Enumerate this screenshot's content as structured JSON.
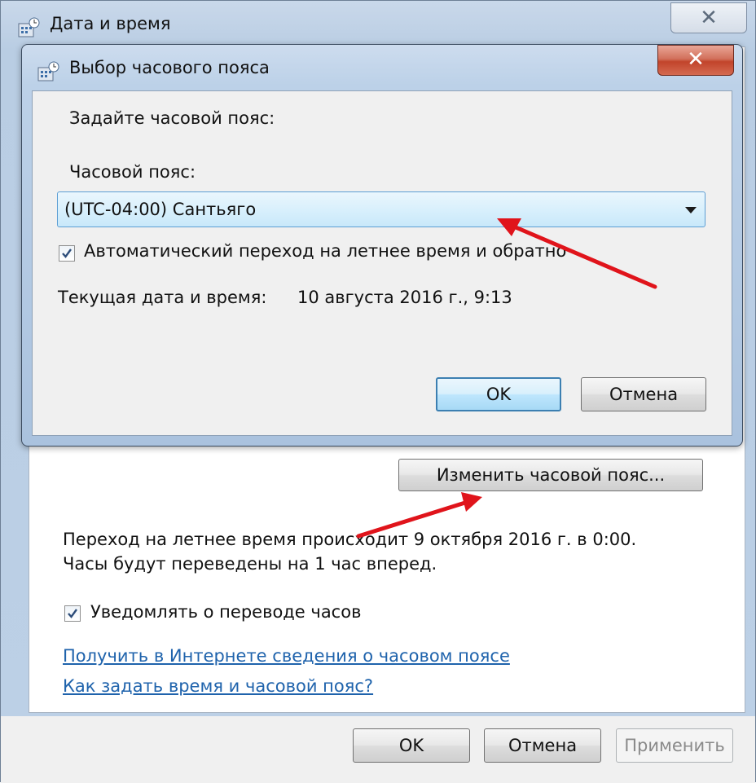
{
  "outer_window": {
    "title": "Дата и время",
    "close_glyph": "✕",
    "change_timezone_button": "Изменить часовой пояс...",
    "dst_info": "Переход на летнее время происходит 9 октября 2016 г. в 0:00. Часы будут переведены на 1 час вперед.",
    "notify_checkbox": {
      "label": "Уведомлять о переводе часов",
      "checked": true
    },
    "links": [
      "Получить в Интернете сведения о часовом поясе",
      "Как задать время и часовой пояс?"
    ],
    "buttons": {
      "ok": "OK",
      "cancel": "Отмена",
      "apply": "Применить"
    },
    "icon": "date-time-icon"
  },
  "timezone_dialog": {
    "title": "Выбор часового пояса",
    "close_glyph": "✕",
    "prompt": "Задайте часовой пояс:",
    "timezone_label": "Часовой пояс:",
    "timezone_value": "(UTC-04:00) Сантьяго",
    "auto_dst_checkbox": {
      "label": "Автоматический переход на летнее время и обратно",
      "checked": true
    },
    "current_datetime_label": "Текущая дата и время:",
    "current_datetime_value": "10 августа 2016 г., 9:13",
    "buttons": {
      "ok": "OK",
      "cancel": "Отмена"
    },
    "icon": "date-time-icon"
  },
  "colors": {
    "link": "#1f63ac",
    "annotation_arrow": "#e0141b",
    "close_button": "#c2442b"
  }
}
